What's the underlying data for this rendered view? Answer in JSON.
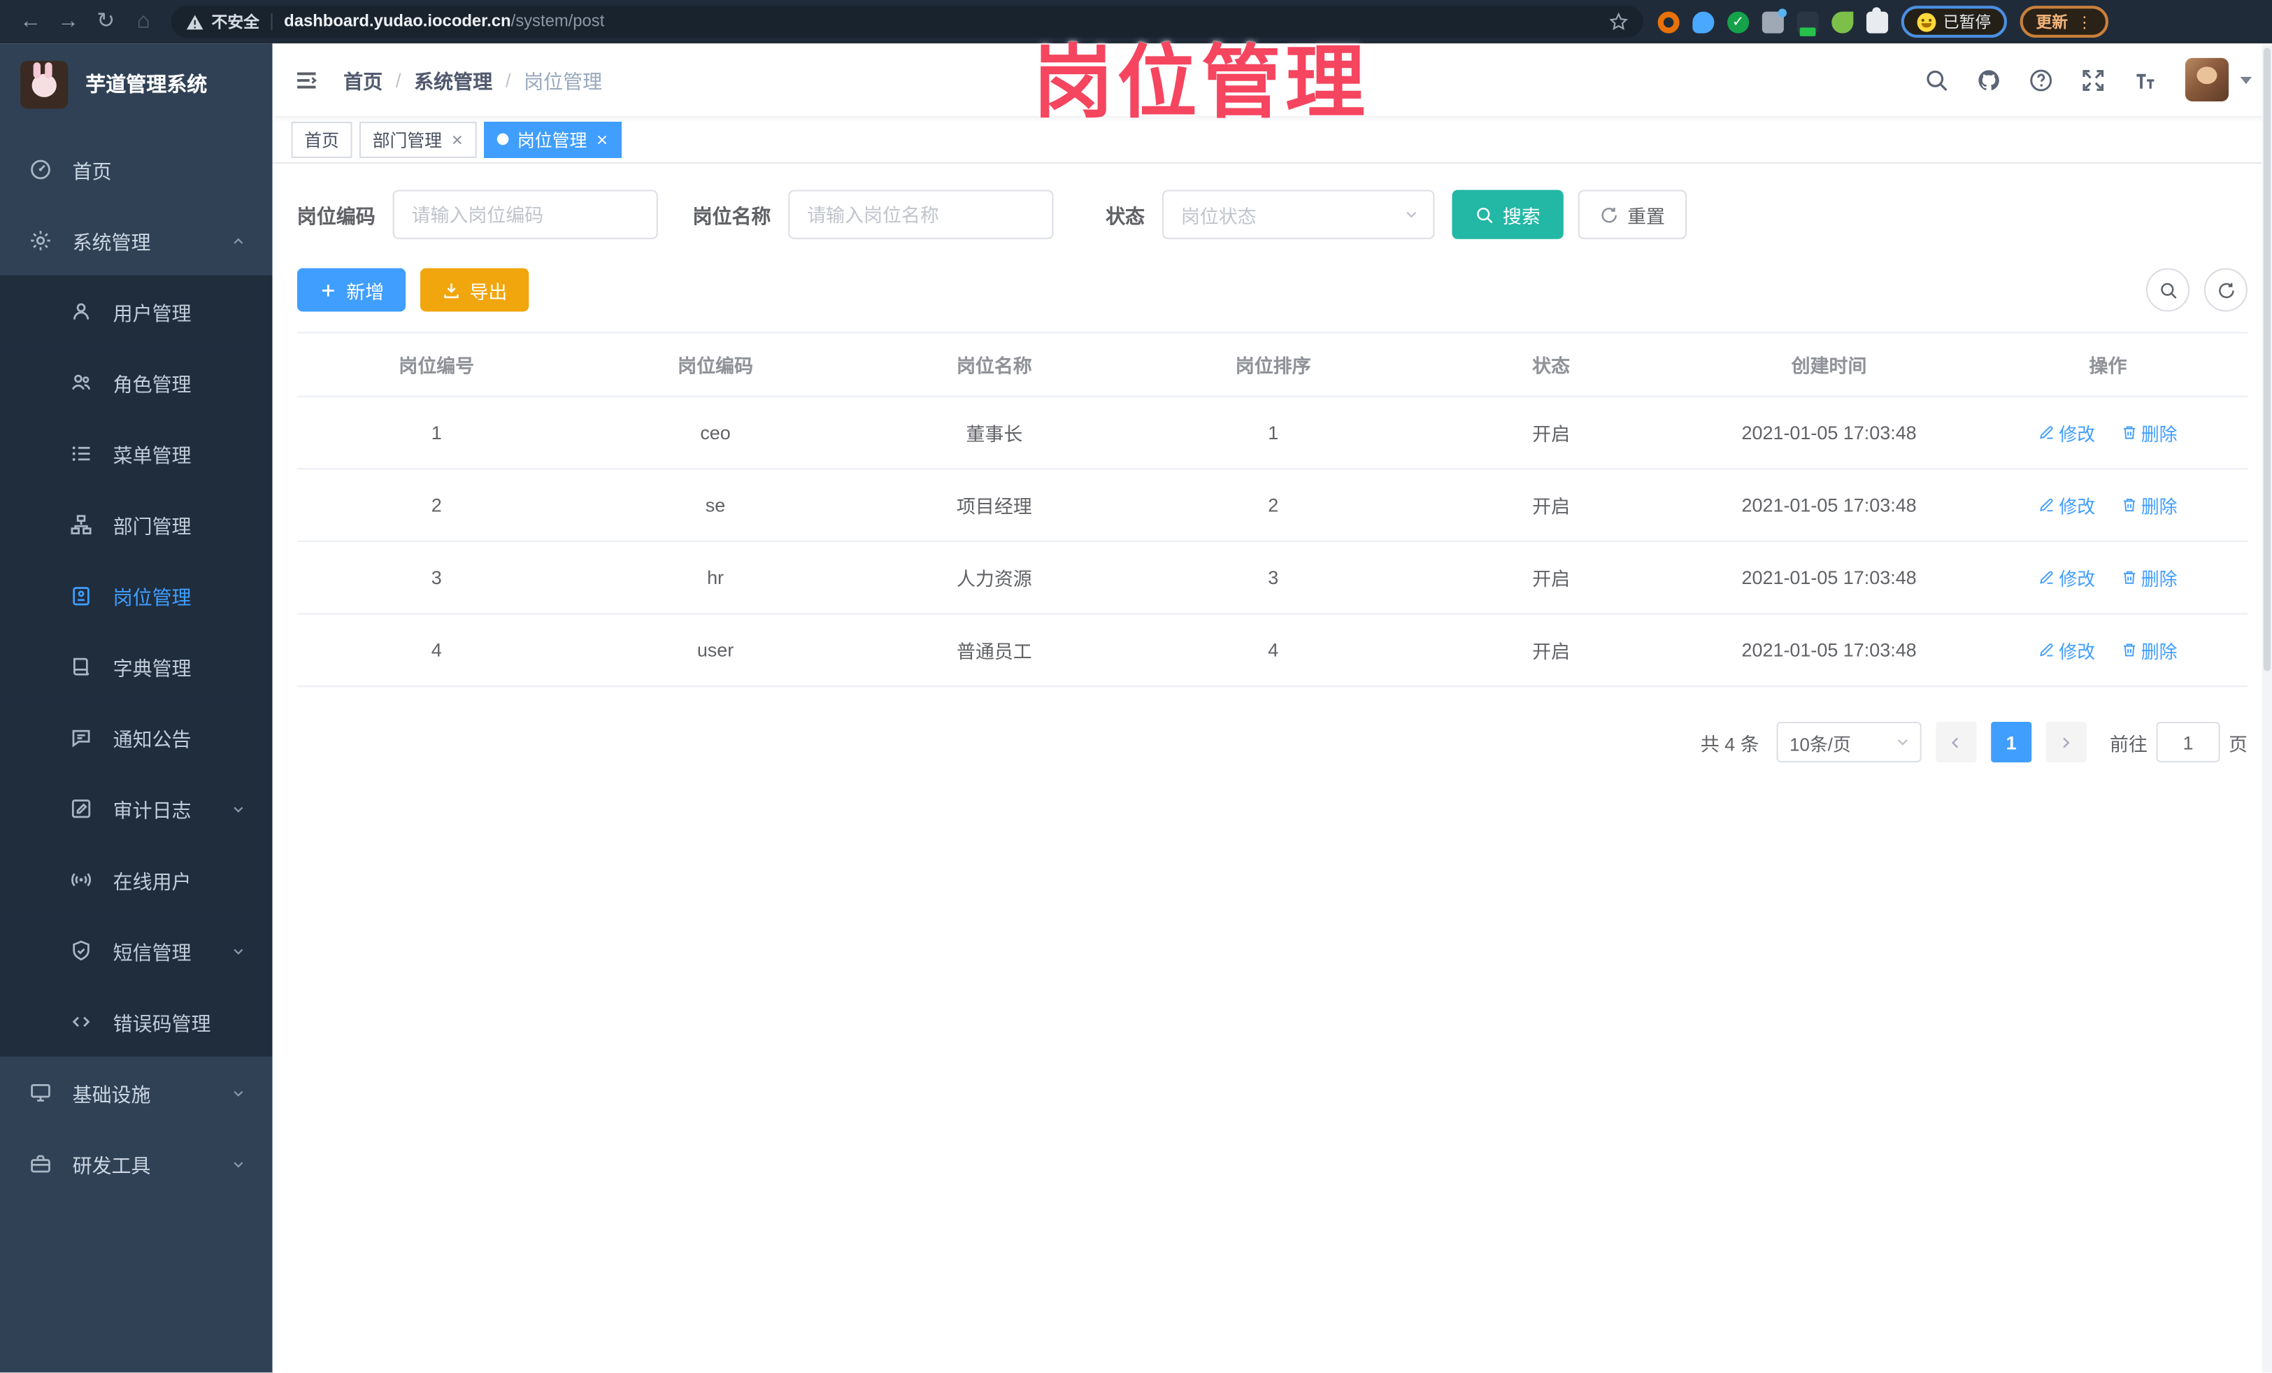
{
  "watermark": "岗位管理",
  "colors": {
    "accent_blue": "#409eff",
    "search_teal": "#23b8a5",
    "export_orange": "#f2a60d",
    "watermark_pink": "#f5455f",
    "sidebar_bg": "#304156",
    "submenu_bg": "#1f2d3d",
    "browser_bar_bg": "#202b39"
  },
  "browser": {
    "security_label": "不安全",
    "url_host": "dashboard.yudao.iocoder.cn",
    "url_path": "/system/post",
    "paused_badge": "已暂停",
    "update_button": "更新",
    "menu_dots": "⋮"
  },
  "sidebar": {
    "app_title": "芋道管理系统",
    "items": [
      {
        "label": "首页",
        "icon": "dashboard-icon",
        "symbol": "dashboard",
        "level": 1
      },
      {
        "label": "系统管理",
        "icon": "gear-icon",
        "symbol": "gear",
        "level": 1,
        "caret": "up"
      },
      {
        "label": "用户管理",
        "icon": "user-icon",
        "symbol": "user",
        "level": 2
      },
      {
        "label": "角色管理",
        "icon": "role-icon",
        "symbol": "role",
        "level": 2
      },
      {
        "label": "菜单管理",
        "icon": "menu-list-icon",
        "symbol": "list",
        "level": 2
      },
      {
        "label": "部门管理",
        "icon": "org-tree-icon",
        "symbol": "tree",
        "level": 2
      },
      {
        "label": "岗位管理",
        "icon": "post-badge-icon",
        "symbol": "post",
        "level": 2,
        "active": true
      },
      {
        "label": "字典管理",
        "icon": "dict-book-icon",
        "symbol": "dict",
        "level": 2
      },
      {
        "label": "通知公告",
        "icon": "notice-icon",
        "symbol": "notice",
        "level": 2
      },
      {
        "label": "审计日志",
        "icon": "audit-log-icon",
        "symbol": "audit",
        "level": 2,
        "caret": "down"
      },
      {
        "label": "在线用户",
        "icon": "online-user-icon",
        "symbol": "online",
        "level": 2
      },
      {
        "label": "短信管理",
        "icon": "sms-shield-icon",
        "symbol": "sms",
        "level": 2,
        "caret": "down"
      },
      {
        "label": "错误码管理",
        "icon": "error-code-icon",
        "symbol": "code",
        "level": 2
      },
      {
        "label": "基础设施",
        "icon": "infra-icon",
        "symbol": "infra",
        "level": 1,
        "caret": "down"
      },
      {
        "label": "研发工具",
        "icon": "dev-tools-icon",
        "symbol": "tools",
        "level": 1,
        "caret": "down"
      }
    ]
  },
  "header": {
    "breadcrumb": {
      "0": "首页",
      "1": "系统管理",
      "2": "岗位管理"
    },
    "separator": "/"
  },
  "tabs": [
    {
      "label": "首页",
      "closable": false,
      "active": false
    },
    {
      "label": "部门管理",
      "closable": true,
      "active": false
    },
    {
      "label": "岗位管理",
      "closable": true,
      "active": true
    }
  ],
  "filters": {
    "post_code_label": "岗位编码",
    "post_code_placeholder": "请输入岗位编码",
    "post_name_label": "岗位名称",
    "post_name_placeholder": "请输入岗位名称",
    "status_label": "状态",
    "status_placeholder": "岗位状态",
    "search_button": "搜索",
    "reset_button": "重置"
  },
  "toolbar": {
    "add_button": "新增",
    "export_button": "导出"
  },
  "table": {
    "headers": [
      "岗位编号",
      "岗位编码",
      "岗位名称",
      "岗位排序",
      "状态",
      "创建时间",
      "操作"
    ],
    "rows": [
      {
        "id": "1",
        "code": "ceo",
        "name": "董事长",
        "sort": "1",
        "status": "开启",
        "created": "2021-01-05 17:03:48"
      },
      {
        "id": "2",
        "code": "se",
        "name": "项目经理",
        "sort": "2",
        "status": "开启",
        "created": "2021-01-05 17:03:48"
      },
      {
        "id": "3",
        "code": "hr",
        "name": "人力资源",
        "sort": "3",
        "status": "开启",
        "created": "2021-01-05 17:03:48"
      },
      {
        "id": "4",
        "code": "user",
        "name": "普通员工",
        "sort": "4",
        "status": "开启",
        "created": "2021-01-05 17:03:48"
      }
    ],
    "edit_label": "修改",
    "delete_label": "删除"
  },
  "pagination": {
    "total_text": "共 4 条",
    "page_size": "10条/页",
    "current_page": "1",
    "goto_label": "前往",
    "goto_value": "1",
    "page_unit": "页"
  }
}
